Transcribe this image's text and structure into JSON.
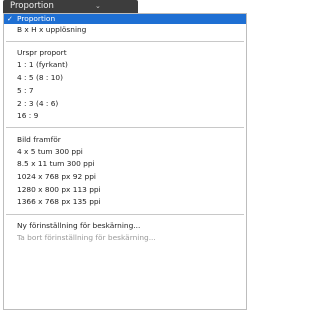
{
  "dropdown": {
    "label": "Proportion",
    "chevron": "⌄"
  },
  "menu": {
    "check_glyph": "✓",
    "items": {
      "proportion": "Proportion",
      "bxh": "B x H x upplösning",
      "orig": "Urspr proport",
      "r11": "1 : 1 (fyrkant)",
      "r45": "4 : 5 (8 : 10)",
      "r57": "5 : 7",
      "r23": "2 : 3 (4 : 6)",
      "r169": "16 : 9",
      "bild": "Bild framför",
      "p1": "4 x 5 tum 300 ppi",
      "p2": "8.5 x 11 tum 300 ppi",
      "p3": "1024 x 768 px 92 ppi",
      "p4": "1280 x 800 px 113 ppi",
      "p5": "1366 x 768 px 135 ppi",
      "new_preset": "Ny förinställning för beskärning...",
      "delete_preset": "Ta bort förinställning för beskärning..."
    }
  }
}
